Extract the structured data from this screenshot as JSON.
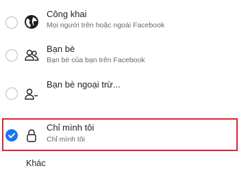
{
  "options": [
    {
      "title": "Công khai",
      "subtitle": "Mọi người trên hoặc ngoài Facebook",
      "icon": "globe-icon",
      "selected": false
    },
    {
      "title": "Bạn bè",
      "subtitle": "Bạn bè của bạn trên Facebook",
      "icon": "friends-icon",
      "selected": false
    },
    {
      "title": "Bạn bè ngoại trừ...",
      "subtitle": "",
      "icon": "friends-except-icon",
      "selected": false
    },
    {
      "title": "Chỉ mình tôi",
      "subtitle": "Chỉ mình tôi",
      "icon": "lock-icon",
      "selected": true
    }
  ],
  "other_label": "Khác",
  "colors": {
    "accent": "#1877f2",
    "highlight_border": "#e0202e"
  }
}
